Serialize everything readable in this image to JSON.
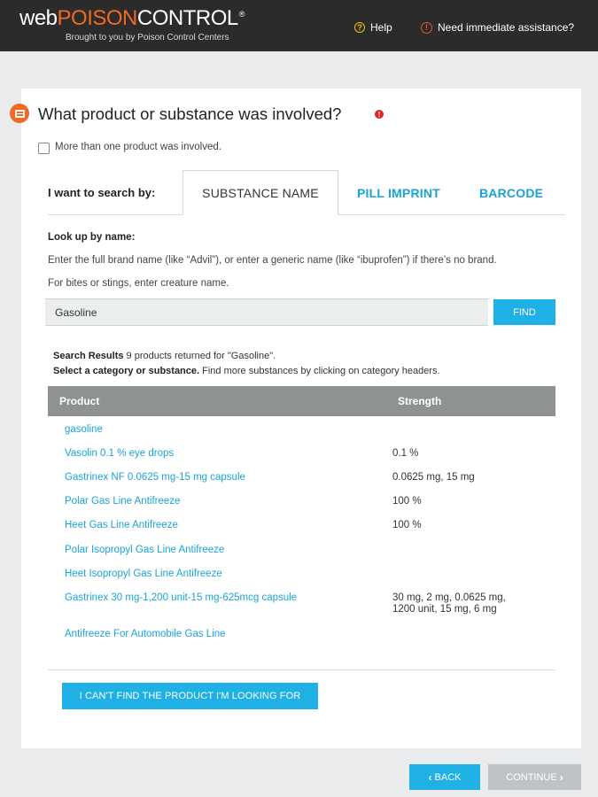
{
  "header": {
    "logo_web": "web",
    "logo_poison": "POISON",
    "logo_control": "CONTROL",
    "logo_reg": "®",
    "tagline": "Brought to you by Poison Control Centers",
    "help_label": "Help",
    "assist_label": "Need immediate assistance?"
  },
  "form": {
    "question": "What product or substance was involved?",
    "multiple_label": "More than one product was involved."
  },
  "tabs": {
    "search_by": "I want to search by:",
    "items": [
      "SUBSTANCE NAME",
      "PILL IMPRINT",
      "BARCODE"
    ],
    "active": "SUBSTANCE NAME"
  },
  "lookup": {
    "title": "Look up by name:",
    "instr1": "Enter the full brand name (like “Advil”), or enter a generic name (like “ibuprofen”) if there’s no brand.",
    "instr2": "For bites or stings, enter creature name.",
    "value": "Gasoline",
    "find_label": "FIND"
  },
  "results": {
    "summary_bold": "Search Results",
    "summary_text": " 9 products returned for \"Gasoline\".",
    "select_bold": "Select a category or substance.",
    "select_text": " Find more substances by clicking on category headers.",
    "col_product": "Product",
    "col_strength": "Strength",
    "rows": [
      {
        "product": "gasoline",
        "strength": ""
      },
      {
        "product": "Vasolin 0.1 % eye drops",
        "strength": "0.1 %"
      },
      {
        "product": "Gastrinex NF 0.0625 mg-15 mg capsule",
        "strength": "0.0625 mg, 15 mg"
      },
      {
        "product": "Polar Gas Line Antifreeze",
        "strength": "100 %"
      },
      {
        "product": "Heet Gas Line Antifreeze",
        "strength": "100 %"
      },
      {
        "product": "Polar Isopropyl Gas Line Antifreeze",
        "strength": ""
      },
      {
        "product": "Heet Isopropyl Gas Line Antifreeze",
        "strength": ""
      },
      {
        "product": "Gastrinex 30 mg-1,200 unit-15 mg-625mcg capsule",
        "strength": "30 mg, 2 mg, 0.0625 mg,\n1200 unit, 15 mg, 6 mg"
      },
      {
        "product": "Antifreeze For Automobile Gas Line",
        "strength": ""
      }
    ],
    "cant_find_label": "I CAN'T FIND THE PRODUCT I'M LOOKING FOR"
  },
  "nav": {
    "back_label": "BACK",
    "continue_label": "CONTINUE"
  }
}
